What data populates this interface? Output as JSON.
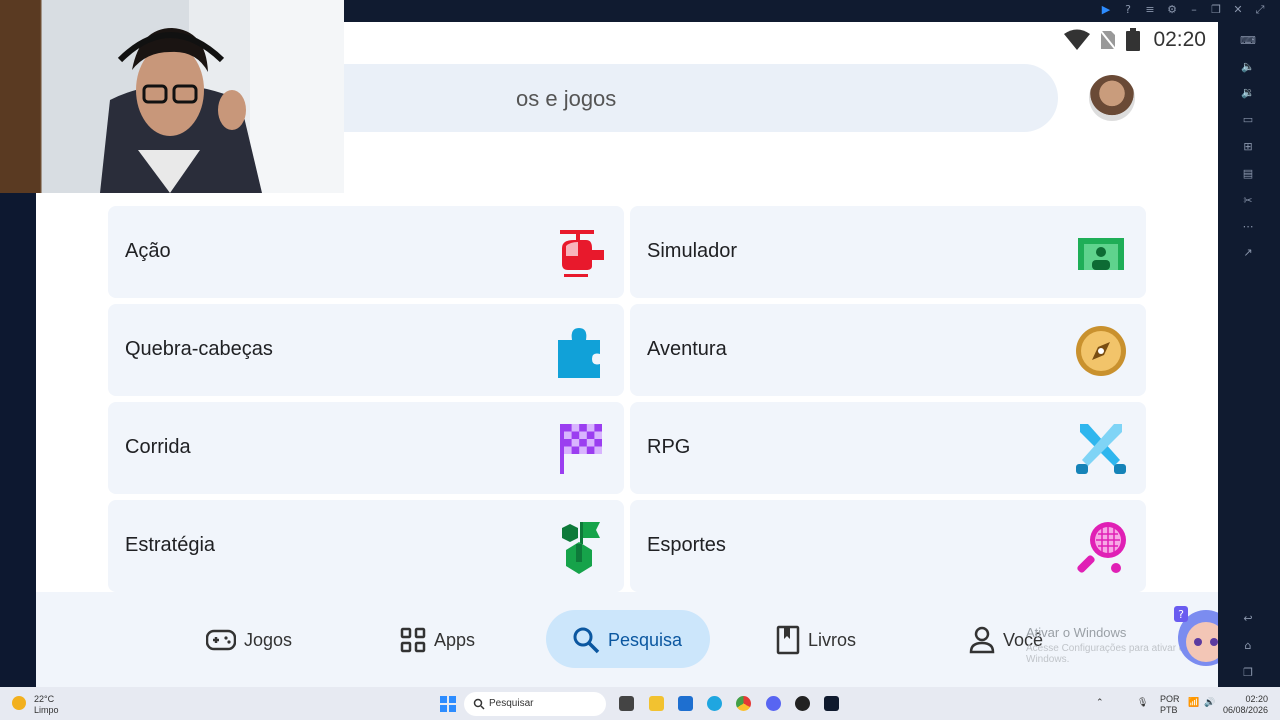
{
  "android": {
    "status": {
      "time": "02:20"
    },
    "search": {
      "placeholder_visible": "os e jogos"
    },
    "categories": [
      {
        "label": "Ação",
        "icon": "helicopter-icon",
        "color": "#e8192c"
      },
      {
        "label": "Simulador",
        "icon": "simulator-icon",
        "color": "#1fae57"
      },
      {
        "label": "Quebra-cabeças",
        "icon": "puzzle-icon",
        "color": "#11a1d8"
      },
      {
        "label": "Aventura",
        "icon": "compass-icon",
        "color": "#c9912e"
      },
      {
        "label": "Corrida",
        "icon": "checkered-flag-icon",
        "color": "#9b3ef0"
      },
      {
        "label": "RPG",
        "icon": "crossed-swords-icon",
        "color": "#2fb6ee"
      },
      {
        "label": "Estratégia",
        "icon": "strategy-flag-icon",
        "color": "#16a34a"
      },
      {
        "label": "Esportes",
        "icon": "tennis-racket-icon",
        "color": "#e020b5"
      }
    ],
    "nav": {
      "games": "Jogos",
      "apps": "Apps",
      "search": "Pesquisa",
      "books": "Livros",
      "you": "Você"
    },
    "watermark": {
      "line1": "Ativar o Windows",
      "line2": "Acesse Configurações para ativar o Windows."
    }
  },
  "taskbar": {
    "weather_temp": "22°C",
    "weather_desc": "Limpo",
    "search_label": "Pesquisar",
    "lang1": "POR",
    "lang2": "PTB",
    "clock_time": "02:20",
    "clock_date": "06/08/2026"
  }
}
